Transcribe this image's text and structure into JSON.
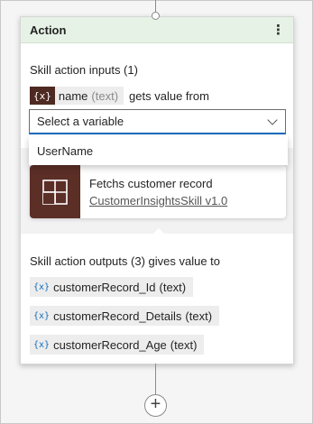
{
  "card": {
    "title": "Action",
    "more_icon": "more-vertical-icon"
  },
  "inputs": {
    "label": "Skill action inputs (1)",
    "var_icon": "{x}",
    "param_name": "name",
    "param_type": "(text)",
    "gets_value_text": "gets value from",
    "select_value": "Select a variable",
    "dropdown_options": [
      "UserName"
    ]
  },
  "skill": {
    "description": "Fetchs customer record",
    "link_text": "CustomerInsightsSkill v1.0",
    "icon": "skill-grid-icon",
    "icon_bg": "#5b2e26"
  },
  "outputs": {
    "label": "Skill action outputs (3) gives value to",
    "var_icon": "{x}",
    "items": [
      {
        "name": "customerRecord_Id",
        "type": "(text)"
      },
      {
        "name": "customerRecord_Details",
        "type": "(text)"
      },
      {
        "name": "customerRecord_Age",
        "type": "(text)"
      }
    ]
  },
  "add_button": "+",
  "colors": {
    "header_bg": "#e6f2e6",
    "accent": "#0f6cbd",
    "var_chip_dark": "#4e2a22"
  }
}
